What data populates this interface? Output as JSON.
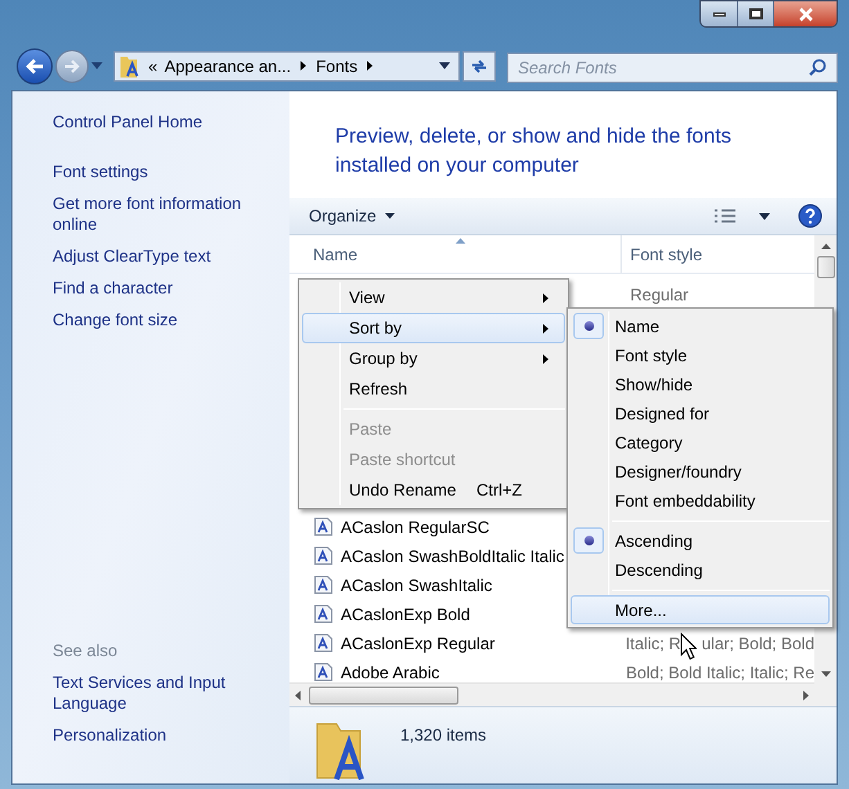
{
  "address_bar": {
    "overflow": "«",
    "crumbs": [
      "Appearance an...",
      "Fonts"
    ]
  },
  "search": {
    "placeholder": "Search Fonts"
  },
  "sidebar": {
    "links": [
      "Control Panel Home",
      "Font settings",
      "Get more font information online",
      "Adjust ClearType text",
      "Find a character",
      "Change font size"
    ],
    "see_also_title": "See also",
    "see_also": [
      "Text Services and Input Language",
      "Personalization"
    ]
  },
  "header": {
    "title": "Preview, delete, or show and hide the fonts installed on your computer"
  },
  "toolbar": {
    "organize": "Organize"
  },
  "table": {
    "columns": [
      {
        "label": "Name",
        "sorted": true
      },
      {
        "label": "Font style",
        "sorted": false
      }
    ],
    "top_rows": [
      {
        "font_style": "Regular"
      }
    ],
    "rows": [
      {
        "name": "ACaslon RegularSC"
      },
      {
        "name": "ACaslon SwashBoldItalic Italic"
      },
      {
        "name": "ACaslon SwashItalic"
      },
      {
        "name": "ACaslonExp Bold"
      },
      {
        "name": "ACaslonExp Regular",
        "font_style": "Italic; R",
        "font_style_after_pointer": "ular; Bold; Bold"
      },
      {
        "name": "Adobe Arabic",
        "font_style": "Bold; Bold Italic; Italic; Re"
      }
    ]
  },
  "context_menu": {
    "items": [
      {
        "kind": "item",
        "label": "View",
        "submenu": true,
        "disabled": false,
        "selected": false
      },
      {
        "kind": "item",
        "label": "Sort by",
        "submenu": true,
        "disabled": false,
        "selected": true
      },
      {
        "kind": "item",
        "label": "Group by",
        "submenu": true,
        "disabled": false,
        "selected": false
      },
      {
        "kind": "item",
        "label": "Refresh",
        "submenu": false,
        "disabled": false,
        "selected": false
      },
      {
        "kind": "separator"
      },
      {
        "kind": "item",
        "label": "Paste",
        "submenu": false,
        "disabled": true,
        "selected": false
      },
      {
        "kind": "item",
        "label": "Paste shortcut",
        "submenu": false,
        "disabled": true,
        "selected": false
      },
      {
        "kind": "item",
        "label": "Undo Rename",
        "shortcut": "Ctrl+Z",
        "submenu": false,
        "disabled": false,
        "selected": false
      }
    ]
  },
  "sort_menu": {
    "items": [
      {
        "kind": "item",
        "label": "Name",
        "checked": true,
        "selected": false
      },
      {
        "kind": "item",
        "label": "Font style",
        "checked": false,
        "selected": false
      },
      {
        "kind": "item",
        "label": "Show/hide",
        "checked": false,
        "selected": false
      },
      {
        "kind": "item",
        "label": "Designed for",
        "checked": false,
        "selected": false
      },
      {
        "kind": "item",
        "label": "Category",
        "checked": false,
        "selected": false
      },
      {
        "kind": "item",
        "label": "Designer/foundry",
        "checked": false,
        "selected": false
      },
      {
        "kind": "item",
        "label": "Font embeddability",
        "checked": false,
        "selected": false
      },
      {
        "kind": "separator"
      },
      {
        "kind": "item",
        "label": "Ascending",
        "checked": true,
        "selected": false
      },
      {
        "kind": "item",
        "label": "Descending",
        "checked": false,
        "selected": false
      },
      {
        "kind": "separator"
      },
      {
        "kind": "item",
        "label": "More...",
        "checked": false,
        "selected": true
      }
    ]
  },
  "details": {
    "count": "1,320 items"
  }
}
